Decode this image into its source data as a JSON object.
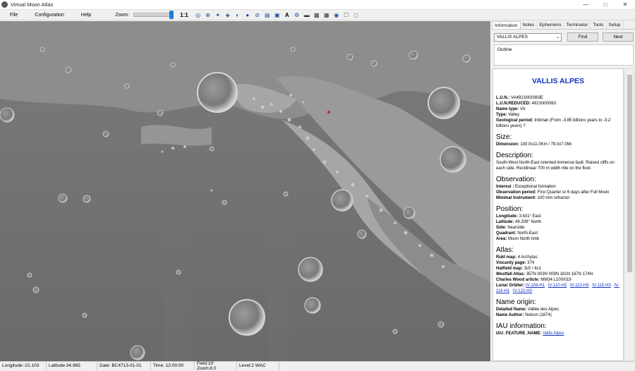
{
  "window": {
    "title": "Virtual Moon Atlas"
  },
  "menu": {
    "file": "File",
    "configuration": "Configuration",
    "help": "Help",
    "zoom_label": "Zoom:",
    "ratio": "1:1"
  },
  "toolbar_icons": [
    "eye-icon",
    "reticle-icon",
    "compass-icon",
    "arrow-icon",
    "moon-phase-icon",
    "moon-dark-icon",
    "orbit-icon",
    "grid-icon",
    "label-icon",
    "font-icon",
    "gear-icon",
    "ruler-icon",
    "camera-icon",
    "image-icon",
    "globe-icon",
    "document-icon",
    "window-icon"
  ],
  "panel": {
    "tabs": [
      "Information",
      "Notes",
      "Ephemeris",
      "Terminator",
      "Tools",
      "Setup"
    ],
    "search_value": "VALLIS ALPES",
    "find_label": "Find",
    "next_label": "Next",
    "outline_label": "Outline"
  },
  "info": {
    "title": "VALLIS ALPES",
    "lun_label": "L.U.N.:",
    "lun": "VA4921N00363E",
    "lunr_label": "L.U.N.REDUCED:",
    "lunr": "4921N00363",
    "nametype_label": "Name type:",
    "nametype": "VA",
    "type_label": "Type:",
    "type": "Valley",
    "geo_label": "Geological period:",
    "geo": "Imbrian (From -3.85 billions years to -3.2 billions years) ?",
    "size_h": "Size:",
    "dim_label": "Dimension:",
    "dim": "130.0x11.0Km / 79.0x7.0Mi",
    "desc_h": "Description:",
    "desc": "South-West North-East oriented immense fault. Raised cliffs on each side. Rectilinear 700 m width rille on the floor.",
    "obs_h": "Observation:",
    "interest_label": "Interest :",
    "interest": "Exceptional formation",
    "period_label": "Observation period:",
    "period": "First Quarter or 6 days after Full Moon",
    "instr_label": "Minimal Instrument:",
    "instr": "100 mm refractor",
    "pos_h": "Position:",
    "lon_label": "Longitude:",
    "lon": "3.631° East",
    "lat_label": "Latitude:",
    "lat": "49.209° North",
    "side_label": "Side:",
    "side": "Nearside",
    "quad_label": "Quadrant:",
    "quad": "North-East",
    "area_label": "Area:",
    "area": "Moon North limb",
    "atlas_h": "Atlas:",
    "rukl_label": "Rukl map:",
    "rukl": "4 Archytas",
    "visc_label": "Viscardy page:",
    "visc": "374",
    "hat_label": "Hatfield map:",
    "hat": "3c5 / 4c1",
    "west_label": "Westfall Atlas:",
    "west": "357N 003N 009N 161N 167N 174N",
    "cw_label": "Charles Wood article:",
    "cw": "MM34 L100/019",
    "lo_label": "Lunar Orbiter:",
    "lo_links": [
      "IV-104-H1",
      "IV-110-H2",
      "IV-110-H3",
      "IV-115-H3",
      "IV-116-H1",
      "IV-122-H3"
    ],
    "origin_h": "Name origin:",
    "detail_label": "Detailed Name:",
    "detail": "Vallée des Alpes",
    "author_label": "Name Author:",
    "author": "Neison (1874)",
    "iau_h": "IAU information:",
    "iau_label": "IAU_FEATURE_NAME:",
    "iau": "Vallis Alpes"
  },
  "status": {
    "longitude": "Longitude:-21.103",
    "latitude": "Latitude:34.965",
    "date": "Date: BC4713-01-01",
    "time": "Time: 12:00:00",
    "field": "Field:10' Zoom:8.0",
    "level": "Level:2 WAC"
  }
}
